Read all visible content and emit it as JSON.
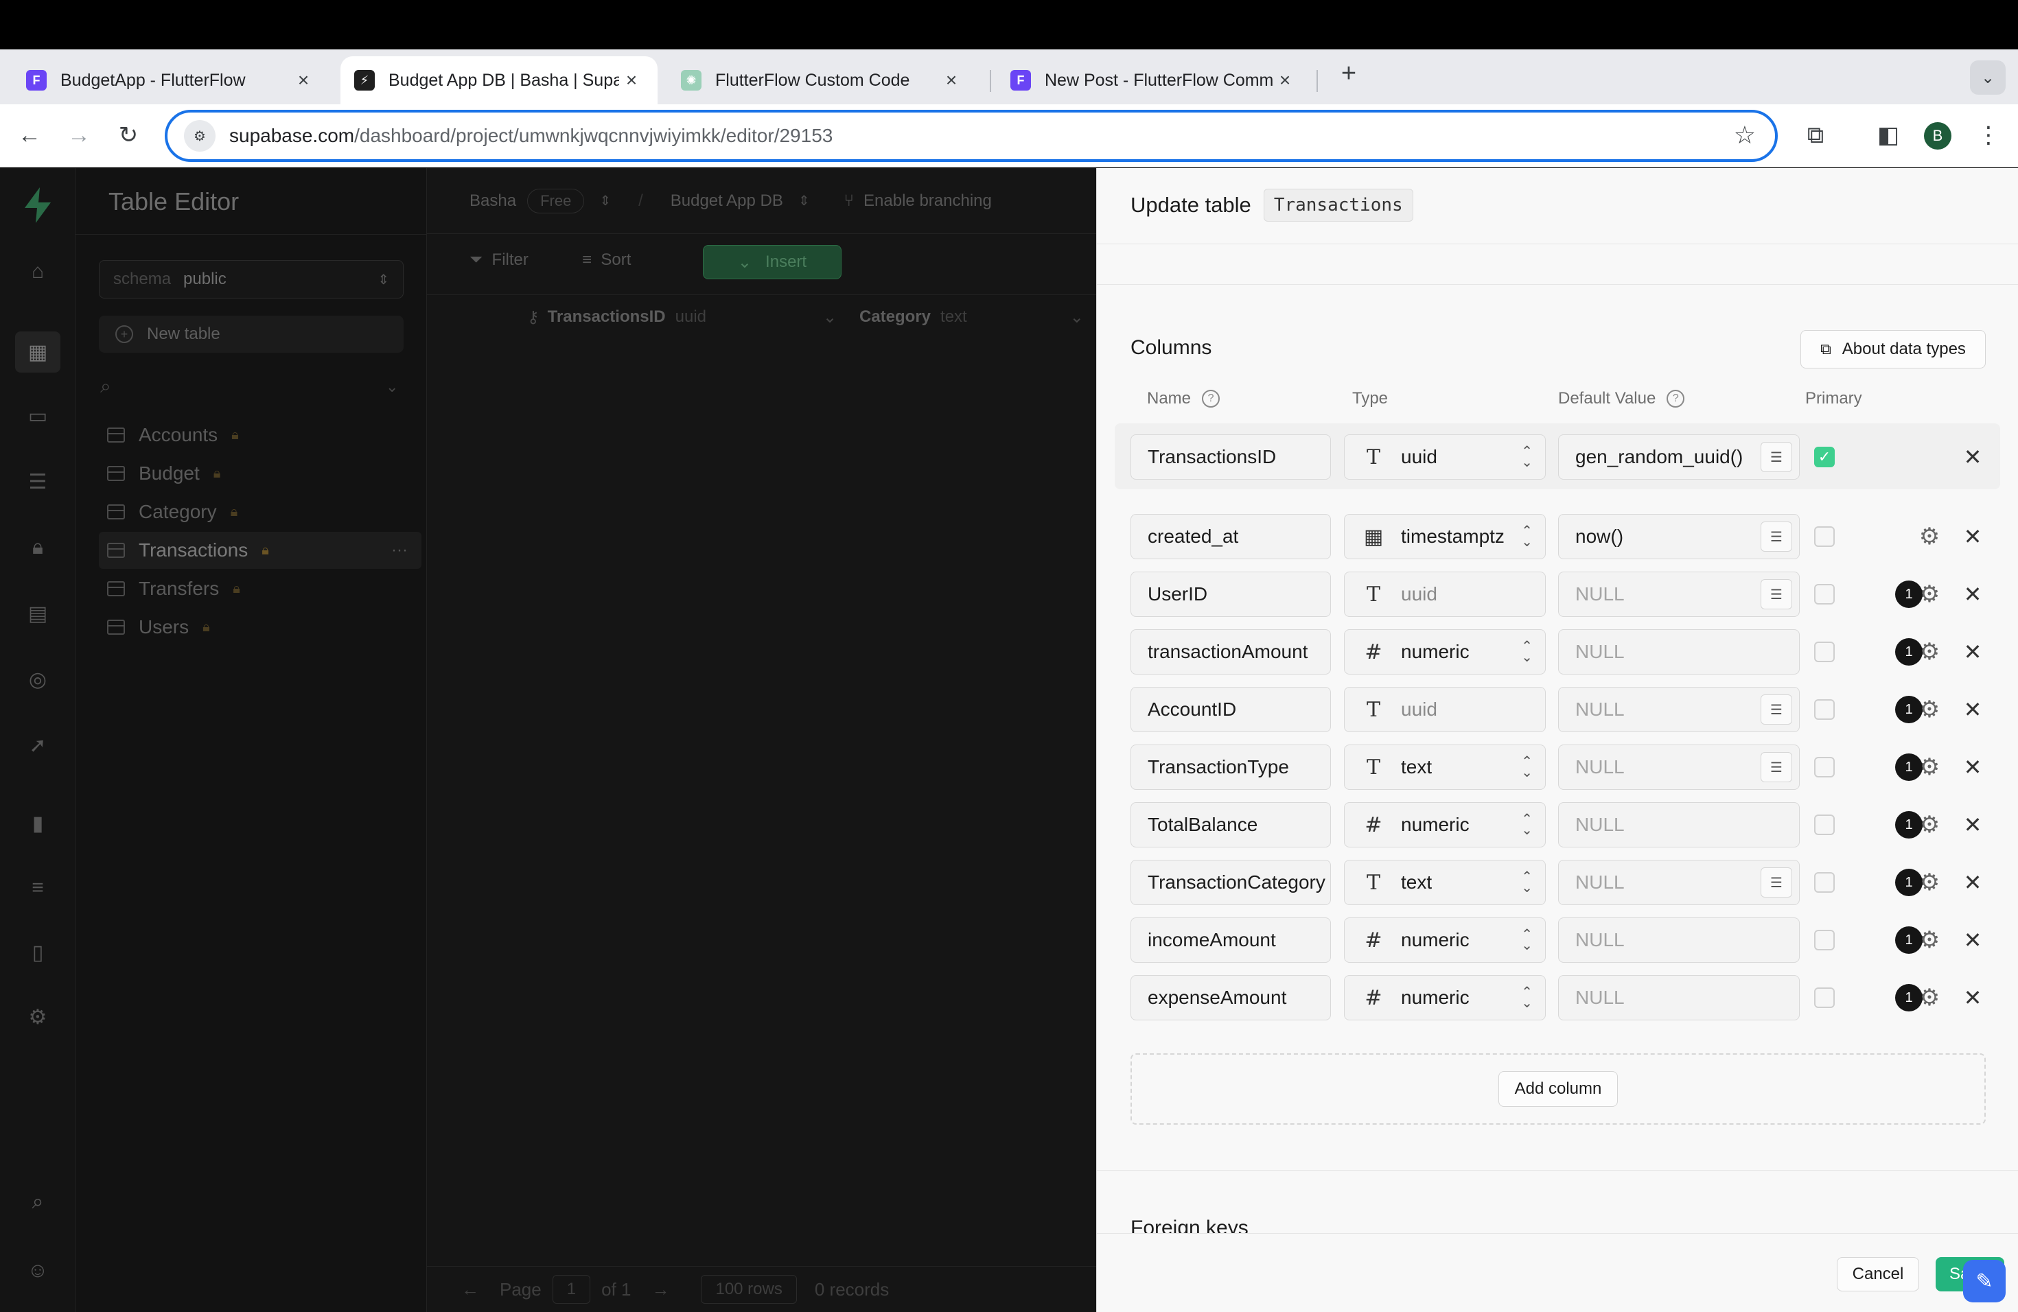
{
  "browser": {
    "tabs": [
      {
        "title": "BudgetApp - FlutterFlow",
        "favicon": "flutterflow-icon",
        "color": "#6a45f5"
      },
      {
        "title": "Budget App DB | Basha | Supa",
        "favicon": "supabase-icon",
        "color": "#1f1f1f"
      },
      {
        "title": "FlutterFlow Custom Code",
        "favicon": "chatgpt-icon",
        "color": "#9bd0b8"
      },
      {
        "title": "New Post - FlutterFlow Comm",
        "favicon": "flutterflow-icon",
        "color": "#6a45f5"
      }
    ],
    "url_host": "supabase.com",
    "url_path": "/dashboard/project/umwnkjwqcnnvjwiyimkk/editor/29153",
    "avatar_letter": "B"
  },
  "sidebar": {
    "title": "Table Editor",
    "schema_label": "schema",
    "schema_value": "public",
    "new_table": "New table",
    "tables": [
      {
        "name": "Accounts"
      },
      {
        "name": "Budget"
      },
      {
        "name": "Category"
      },
      {
        "name": "Transactions",
        "active": true
      },
      {
        "name": "Transfers"
      },
      {
        "name": "Users"
      }
    ]
  },
  "main": {
    "org": "Basha",
    "plan": "Free",
    "project": "Budget App DB",
    "branching": "Enable branching",
    "filter": "Filter",
    "sort": "Sort",
    "insert": "Insert",
    "columns": [
      {
        "name": "TransactionsID",
        "type": "uuid"
      },
      {
        "name": "Category",
        "type": "text"
      }
    ],
    "pager": {
      "page_label": "Page",
      "page": "1",
      "of": "of 1",
      "rows": "100 rows",
      "records": "0 records"
    }
  },
  "panel": {
    "title": "Update table",
    "table_name": "Transactions",
    "columns_title": "Columns",
    "about_btn": "About data types",
    "headers": {
      "name": "Name",
      "type": "Type",
      "default": "Default Value",
      "primary": "Primary"
    },
    "rows": [
      {
        "name": "TransactionsID",
        "type": "uuid",
        "glyph": "T",
        "default": "gen_random_uuid()",
        "primary": true,
        "list": true,
        "badge": "",
        "gear": false
      },
      {
        "name": "created_at",
        "type": "timestamptz",
        "glyph": "calendar",
        "default": "now()",
        "primary": false,
        "list": true,
        "badge": "",
        "gear": true
      },
      {
        "name": "UserID",
        "type": "uuid",
        "glyph": "T",
        "default": "NULL",
        "primary": false,
        "list": true,
        "badge": "1",
        "gear": true,
        "locked": true
      },
      {
        "name": "transactionAmount",
        "type": "numeric",
        "glyph": "#",
        "default": "NULL",
        "primary": false,
        "list": false,
        "badge": "1",
        "gear": true
      },
      {
        "name": "AccountID",
        "type": "uuid",
        "glyph": "T",
        "default": "NULL",
        "primary": false,
        "list": true,
        "badge": "1",
        "gear": true,
        "locked": true
      },
      {
        "name": "TransactionType",
        "type": "text",
        "glyph": "T",
        "default": "NULL",
        "primary": false,
        "list": true,
        "badge": "1",
        "gear": true
      },
      {
        "name": "TotalBalance",
        "type": "numeric",
        "glyph": "#",
        "default": "NULL",
        "primary": false,
        "list": false,
        "badge": "1",
        "gear": true
      },
      {
        "name": "TransactionCategory",
        "type": "text",
        "glyph": "T",
        "default": "NULL",
        "primary": false,
        "list": true,
        "badge": "1",
        "gear": true
      },
      {
        "name": "incomeAmount",
        "type": "numeric",
        "glyph": "#",
        "default": "NULL",
        "primary": false,
        "list": false,
        "badge": "1",
        "gear": true
      },
      {
        "name": "expenseAmount",
        "type": "numeric",
        "glyph": "#",
        "default": "NULL",
        "primary": false,
        "list": false,
        "badge": "1",
        "gear": true
      }
    ],
    "add_column": "Add column",
    "foreign_keys": "Foreign keys",
    "cancel": "Cancel",
    "save": "Save"
  },
  "colors": {
    "accent": "#3ecf8e",
    "save": "#24b47e",
    "omnibox_border": "#1a73e8"
  }
}
